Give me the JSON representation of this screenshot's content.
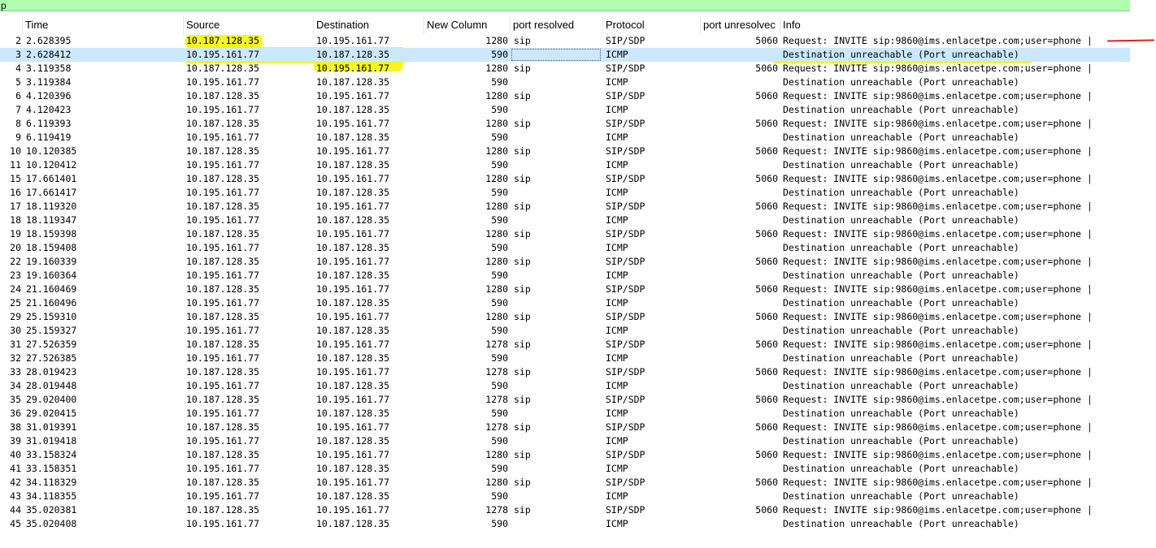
{
  "filter": {
    "text": "p"
  },
  "columns": {
    "no": "",
    "time": "Time",
    "source": "Source",
    "destination": "Destination",
    "new_column": "New Column",
    "port_resolved": "port resolved",
    "protocol": "Protocol",
    "port_unresolved": "port unresolvec",
    "info": "Info"
  },
  "colors": {
    "filter_bg": "#afffaf",
    "selected_row": "#cce8ff",
    "highlight": "#f5f500",
    "annotation_red": "#e0201c"
  },
  "rows": [
    {
      "no": "2",
      "time": "2.628395",
      "src": "10.187.128.35",
      "dst": "10.195.161.77",
      "newcol": "1280",
      "portres": "sip",
      "proto": "SIP/SDP",
      "portunres": "5060",
      "info": "Request: INVITE sip:9860@ims.enlacetpe.com;user=phone |"
    },
    {
      "no": "3",
      "time": "2.628412",
      "src": "10.195.161.77",
      "dst": "10.187.128.35",
      "newcol": "590",
      "portres": "",
      "proto": "ICMP",
      "portunres": "",
      "info": "Destination unreachable (Port unreachable)"
    },
    {
      "no": "4",
      "time": "3.119358",
      "src": "10.187.128.35",
      "dst": "10.195.161.77",
      "newcol": "1280",
      "portres": "sip",
      "proto": "SIP/SDP",
      "portunres": "5060",
      "info": "Request: INVITE sip:9860@ims.enlacetpe.com;user=phone |"
    },
    {
      "no": "5",
      "time": "3.119384",
      "src": "10.195.161.77",
      "dst": "10.187.128.35",
      "newcol": "590",
      "portres": "",
      "proto": "ICMP",
      "portunres": "",
      "info": "Destination unreachable (Port unreachable)"
    },
    {
      "no": "6",
      "time": "4.120396",
      "src": "10.187.128.35",
      "dst": "10.195.161.77",
      "newcol": "1280",
      "portres": "sip",
      "proto": "SIP/SDP",
      "portunres": "5060",
      "info": "Request: INVITE sip:9860@ims.enlacetpe.com;user=phone |"
    },
    {
      "no": "7",
      "time": "4.120423",
      "src": "10.195.161.77",
      "dst": "10.187.128.35",
      "newcol": "590",
      "portres": "",
      "proto": "ICMP",
      "portunres": "",
      "info": "Destination unreachable (Port unreachable)"
    },
    {
      "no": "8",
      "time": "6.119393",
      "src": "10.187.128.35",
      "dst": "10.195.161.77",
      "newcol": "1280",
      "portres": "sip",
      "proto": "SIP/SDP",
      "portunres": "5060",
      "info": "Request: INVITE sip:9860@ims.enlacetpe.com;user=phone |"
    },
    {
      "no": "9",
      "time": "6.119419",
      "src": "10.195.161.77",
      "dst": "10.187.128.35",
      "newcol": "590",
      "portres": "",
      "proto": "ICMP",
      "portunres": "",
      "info": "Destination unreachable (Port unreachable)"
    },
    {
      "no": "10",
      "time": "10.120385",
      "src": "10.187.128.35",
      "dst": "10.195.161.77",
      "newcol": "1280",
      "portres": "sip",
      "proto": "SIP/SDP",
      "portunres": "5060",
      "info": "Request: INVITE sip:9860@ims.enlacetpe.com;user=phone |"
    },
    {
      "no": "11",
      "time": "10.120412",
      "src": "10.195.161.77",
      "dst": "10.187.128.35",
      "newcol": "590",
      "portres": "",
      "proto": "ICMP",
      "portunres": "",
      "info": "Destination unreachable (Port unreachable)"
    },
    {
      "no": "15",
      "time": "17.661401",
      "src": "10.187.128.35",
      "dst": "10.195.161.77",
      "newcol": "1280",
      "portres": "sip",
      "proto": "SIP/SDP",
      "portunres": "5060",
      "info": "Request: INVITE sip:9860@ims.enlacetpe.com;user=phone |"
    },
    {
      "no": "16",
      "time": "17.661417",
      "src": "10.195.161.77",
      "dst": "10.187.128.35",
      "newcol": "590",
      "portres": "",
      "proto": "ICMP",
      "portunres": "",
      "info": "Destination unreachable (Port unreachable)"
    },
    {
      "no": "17",
      "time": "18.119320",
      "src": "10.187.128.35",
      "dst": "10.195.161.77",
      "newcol": "1280",
      "portres": "sip",
      "proto": "SIP/SDP",
      "portunres": "5060",
      "info": "Request: INVITE sip:9860@ims.enlacetpe.com;user=phone |"
    },
    {
      "no": "18",
      "time": "18.119347",
      "src": "10.195.161.77",
      "dst": "10.187.128.35",
      "newcol": "590",
      "portres": "",
      "proto": "ICMP",
      "portunres": "",
      "info": "Destination unreachable (Port unreachable)"
    },
    {
      "no": "19",
      "time": "18.159398",
      "src": "10.187.128.35",
      "dst": "10.195.161.77",
      "newcol": "1280",
      "portres": "sip",
      "proto": "SIP/SDP",
      "portunres": "5060",
      "info": "Request: INVITE sip:9860@ims.enlacetpe.com;user=phone |"
    },
    {
      "no": "20",
      "time": "18.159408",
      "src": "10.195.161.77",
      "dst": "10.187.128.35",
      "newcol": "590",
      "portres": "",
      "proto": "ICMP",
      "portunres": "",
      "info": "Destination unreachable (Port unreachable)"
    },
    {
      "no": "22",
      "time": "19.160339",
      "src": "10.187.128.35",
      "dst": "10.195.161.77",
      "newcol": "1280",
      "portres": "sip",
      "proto": "SIP/SDP",
      "portunres": "5060",
      "info": "Request: INVITE sip:9860@ims.enlacetpe.com;user=phone |"
    },
    {
      "no": "23",
      "time": "19.160364",
      "src": "10.195.161.77",
      "dst": "10.187.128.35",
      "newcol": "590",
      "portres": "",
      "proto": "ICMP",
      "portunres": "",
      "info": "Destination unreachable (Port unreachable)"
    },
    {
      "no": "24",
      "time": "21.160469",
      "src": "10.187.128.35",
      "dst": "10.195.161.77",
      "newcol": "1280",
      "portres": "sip",
      "proto": "SIP/SDP",
      "portunres": "5060",
      "info": "Request: INVITE sip:9860@ims.enlacetpe.com;user=phone |"
    },
    {
      "no": "25",
      "time": "21.160496",
      "src": "10.195.161.77",
      "dst": "10.187.128.35",
      "newcol": "590",
      "portres": "",
      "proto": "ICMP",
      "portunres": "",
      "info": "Destination unreachable (Port unreachable)"
    },
    {
      "no": "29",
      "time": "25.159310",
      "src": "10.187.128.35",
      "dst": "10.195.161.77",
      "newcol": "1280",
      "portres": "sip",
      "proto": "SIP/SDP",
      "portunres": "5060",
      "info": "Request: INVITE sip:9860@ims.enlacetpe.com;user=phone |"
    },
    {
      "no": "30",
      "time": "25.159327",
      "src": "10.195.161.77",
      "dst": "10.187.128.35",
      "newcol": "590",
      "portres": "",
      "proto": "ICMP",
      "portunres": "",
      "info": "Destination unreachable (Port unreachable)"
    },
    {
      "no": "31",
      "time": "27.526359",
      "src": "10.187.128.35",
      "dst": "10.195.161.77",
      "newcol": "1278",
      "portres": "sip",
      "proto": "SIP/SDP",
      "portunres": "5060",
      "info": "Request: INVITE sip:9860@ims.enlacetpe.com;user=phone |"
    },
    {
      "no": "32",
      "time": "27.526385",
      "src": "10.195.161.77",
      "dst": "10.187.128.35",
      "newcol": "590",
      "portres": "",
      "proto": "ICMP",
      "portunres": "",
      "info": "Destination unreachable (Port unreachable)"
    },
    {
      "no": "33",
      "time": "28.019423",
      "src": "10.187.128.35",
      "dst": "10.195.161.77",
      "newcol": "1278",
      "portres": "sip",
      "proto": "SIP/SDP",
      "portunres": "5060",
      "info": "Request: INVITE sip:9860@ims.enlacetpe.com;user=phone |"
    },
    {
      "no": "34",
      "time": "28.019448",
      "src": "10.195.161.77",
      "dst": "10.187.128.35",
      "newcol": "590",
      "portres": "",
      "proto": "ICMP",
      "portunres": "",
      "info": "Destination unreachable (Port unreachable)"
    },
    {
      "no": "35",
      "time": "29.020400",
      "src": "10.187.128.35",
      "dst": "10.195.161.77",
      "newcol": "1278",
      "portres": "sip",
      "proto": "SIP/SDP",
      "portunres": "5060",
      "info": "Request: INVITE sip:9860@ims.enlacetpe.com;user=phone |"
    },
    {
      "no": "36",
      "time": "29.020415",
      "src": "10.195.161.77",
      "dst": "10.187.128.35",
      "newcol": "590",
      "portres": "",
      "proto": "ICMP",
      "portunres": "",
      "info": "Destination unreachable (Port unreachable)"
    },
    {
      "no": "38",
      "time": "31.019391",
      "src": "10.187.128.35",
      "dst": "10.195.161.77",
      "newcol": "1278",
      "portres": "sip",
      "proto": "SIP/SDP",
      "portunres": "5060",
      "info": "Request: INVITE sip:9860@ims.enlacetpe.com;user=phone |"
    },
    {
      "no": "39",
      "time": "31.019418",
      "src": "10.195.161.77",
      "dst": "10.187.128.35",
      "newcol": "590",
      "portres": "",
      "proto": "ICMP",
      "portunres": "",
      "info": "Destination unreachable (Port unreachable)"
    },
    {
      "no": "40",
      "time": "33.158324",
      "src": "10.187.128.35",
      "dst": "10.195.161.77",
      "newcol": "1280",
      "portres": "sip",
      "proto": "SIP/SDP",
      "portunres": "5060",
      "info": "Request: INVITE sip:9860@ims.enlacetpe.com;user=phone |"
    },
    {
      "no": "41",
      "time": "33.158351",
      "src": "10.195.161.77",
      "dst": "10.187.128.35",
      "newcol": "590",
      "portres": "",
      "proto": "ICMP",
      "portunres": "",
      "info": "Destination unreachable (Port unreachable)"
    },
    {
      "no": "42",
      "time": "34.118329",
      "src": "10.187.128.35",
      "dst": "10.195.161.77",
      "newcol": "1280",
      "portres": "sip",
      "proto": "SIP/SDP",
      "portunres": "5060",
      "info": "Request: INVITE sip:9860@ims.enlacetpe.com;user=phone |"
    },
    {
      "no": "43",
      "time": "34.118355",
      "src": "10.195.161.77",
      "dst": "10.187.128.35",
      "newcol": "590",
      "portres": "",
      "proto": "ICMP",
      "portunres": "",
      "info": "Destination unreachable (Port unreachable)"
    },
    {
      "no": "44",
      "time": "35.020381",
      "src": "10.187.128.35",
      "dst": "10.195.161.77",
      "newcol": "1278",
      "portres": "sip",
      "proto": "SIP/SDP",
      "portunres": "5060",
      "info": "Request: INVITE sip:9860@ims.enlacetpe.com;user=phone |"
    },
    {
      "no": "45",
      "time": "35.020408",
      "src": "10.195.161.77",
      "dst": "10.187.128.35",
      "newcol": "590",
      "portres": "",
      "proto": "ICMP",
      "portunres": "",
      "info": "Destination unreachable (Port unreachable)"
    }
  ]
}
